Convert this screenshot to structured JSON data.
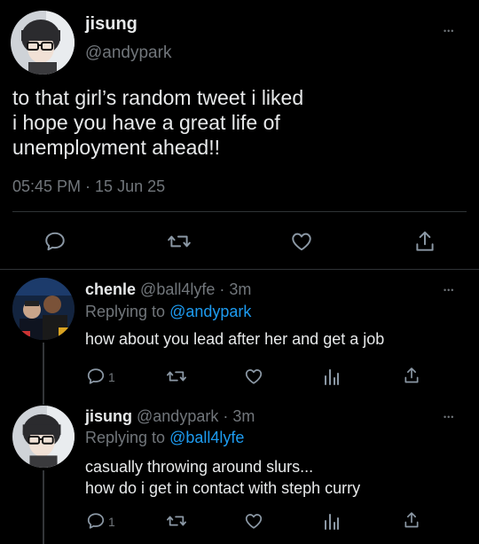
{
  "main_tweet": {
    "display_name": "jisung",
    "handle": "@andypark",
    "text_line1": "to that girl’s random tweet i liked",
    "text_line2": "i hope you have a great life of",
    "text_line3": "unemployment ahead!!",
    "timestamp": "05:45 PM · 15 Jun 25",
    "more_label": "•••"
  },
  "replies": [
    {
      "display_name": "chenle",
      "handle_time": "@ball4lyfe · 3m",
      "replying_prefix": "Replying to",
      "replying_to": "@andypark",
      "text_line1": "how about you lead after her and get a job",
      "text_line2": "",
      "reply_count": "1",
      "more_label": "•••"
    },
    {
      "display_name": "jisung",
      "handle_time": "@andypark · 3m",
      "replying_prefix": "Replying to",
      "replying_to": "@ball4lyfe",
      "text_line1": "casually throwing around slurs...",
      "text_line2": "how do i get in contact with steph curry",
      "reply_count": "1",
      "more_label": "•••"
    }
  ],
  "icons": {
    "reply": "reply-icon",
    "retweet": "retweet-icon",
    "like": "heart-icon",
    "analytics": "analytics-icon",
    "share": "share-icon"
  },
  "colors": {
    "background": "#000000",
    "text": "#e7e9ea",
    "muted": "#71767b",
    "link": "#1d9bf0",
    "divider": "#2f3336"
  }
}
